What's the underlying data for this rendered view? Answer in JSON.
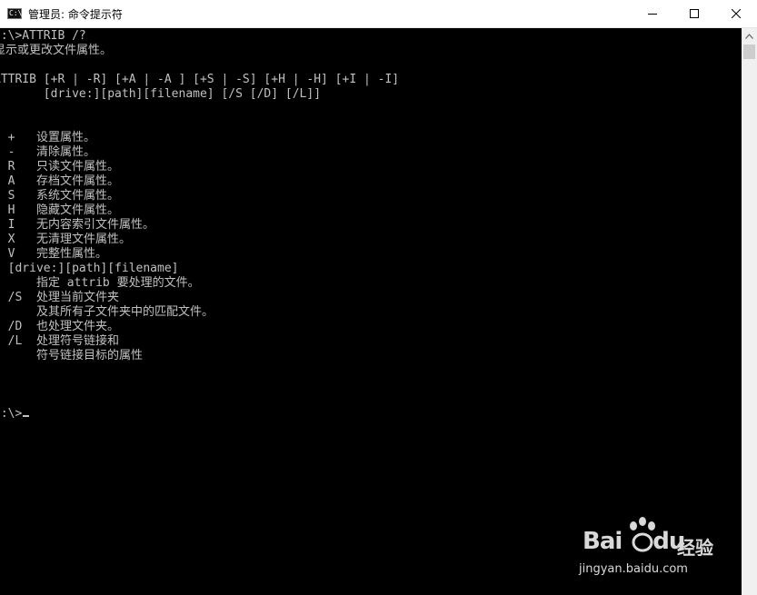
{
  "window": {
    "title": "管理员: 命令提示符",
    "app_icon_glyph": "C:\\",
    "icons": {
      "minimize": "minimize-icon",
      "maximize": "maximize-icon",
      "close": "close-icon"
    }
  },
  "console": {
    "lines": [
      "D:\\>ATTRIB /?",
      "显示或更改文件属性。",
      "",
      "ATTRIB [+R | -R] [+A | -A ] [+S | -S] [+H | -H] [+I | -I]",
      "       [drive:][path][filename] [/S [/D] [/L]]",
      "",
      "",
      "  +   设置属性。",
      "  -   清除属性。",
      "  R   只读文件属性。",
      "  A   存档文件属性。",
      "  S   系统文件属性。",
      "  H   隐藏文件属性。",
      "  I   无内容索引文件属性。",
      "  X   无清理文件属性。",
      "  V   完整性属性。",
      "  [drive:][path][filename]",
      "      指定 attrib 要处理的文件。",
      "  /S  处理当前文件夹",
      "      及其所有子文件夹中的匹配文件。",
      "  /D  也处理文件夹。",
      "  /L  处理符号链接和",
      "      符号链接目标的属性",
      "",
      "",
      ""
    ],
    "prompt": "D:\\>",
    "colors": {
      "background": "#000000",
      "foreground": "#c0c0c0"
    }
  },
  "watermark": {
    "brand": "Bai",
    "brand_suffix": "du",
    "cn": "经验",
    "url": "jingyan.baidu.com"
  }
}
